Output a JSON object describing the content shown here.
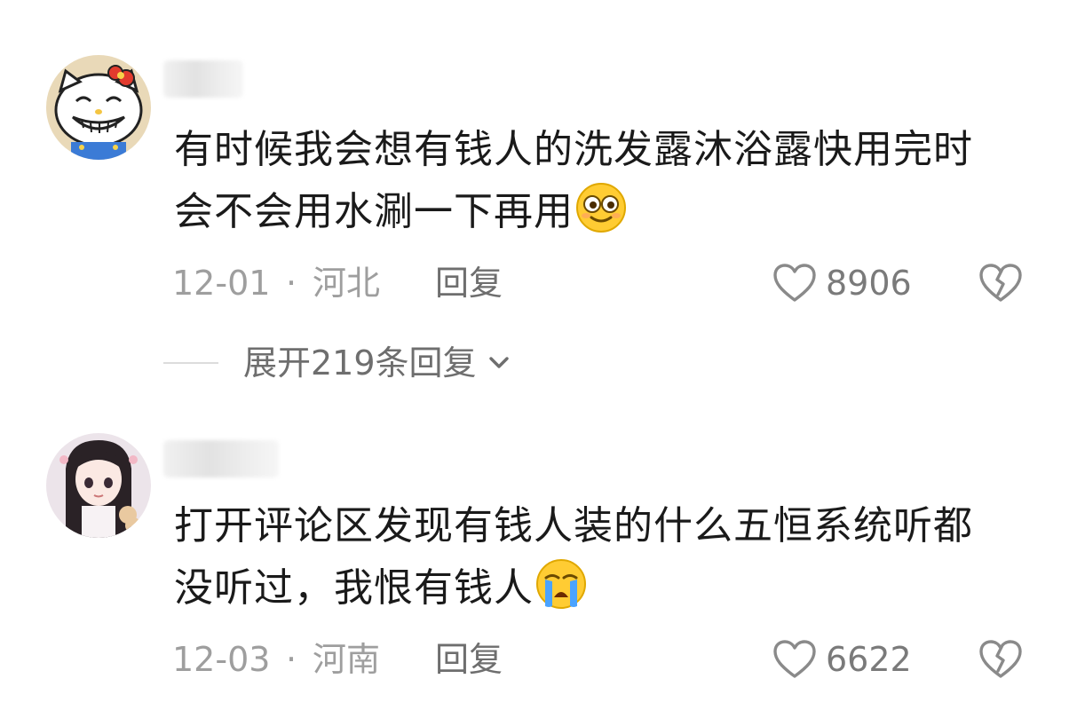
{
  "comments": [
    {
      "avatar_icon": "cartoon-cat-avatar-icon",
      "username": "",
      "text_line1": "有时候我会想有钱人的洗发露沐浴露快用完时",
      "text_line2": "会不会用水涮一下再用",
      "emoji_icon": "smiling-flushed-emoji-icon",
      "date": "12-01",
      "separator": "·",
      "location": "河北",
      "reply_label": "回复",
      "like_count": "8906"
    },
    {
      "avatar_icon": "anime-girl-avatar-icon",
      "username": "",
      "text_line1": "打开评论区发现有钱人装的什么五恒系统听都",
      "text_line2": "没听过，我恨有钱人",
      "emoji_icon": "loudly-crying-emoji-icon",
      "date": "12-03",
      "separator": "·",
      "location": "河南",
      "reply_label": "回复",
      "like_count": "6622"
    }
  ],
  "expand_replies": {
    "label": "展开219条回复"
  },
  "colors": {
    "text": "#1a1a1a",
    "meta": "#9e9e9e",
    "icon_stroke": "#8a8a8a"
  }
}
